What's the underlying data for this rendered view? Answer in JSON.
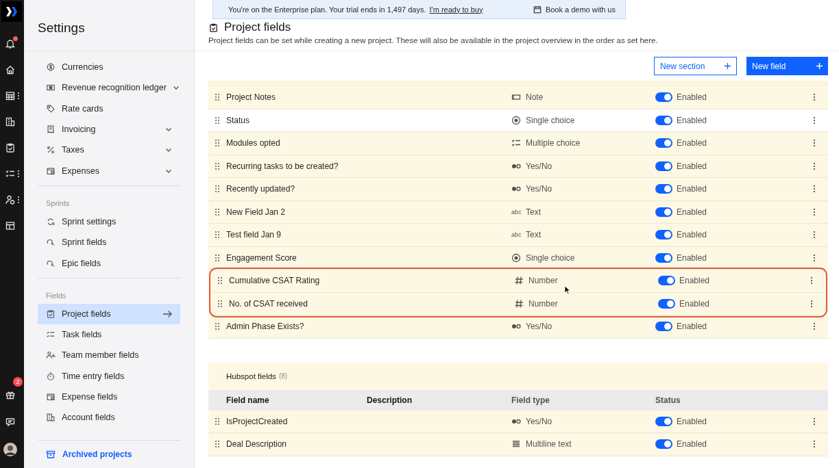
{
  "rail": {
    "top": [
      {
        "kind": "bell",
        "more": false,
        "notification": true
      },
      {
        "kind": "home",
        "more": false,
        "notification": false
      },
      {
        "kind": "calendar",
        "more": true,
        "notification": false
      },
      {
        "kind": "building",
        "more": false,
        "notification": false
      },
      {
        "kind": "clipboard",
        "more": false,
        "notification": false
      },
      {
        "kind": "checklist",
        "more": true,
        "notification": false
      },
      {
        "kind": "person",
        "more": true,
        "notification": false
      },
      {
        "kind": "layout",
        "more": false,
        "notification": false
      }
    ],
    "bottom": [
      {
        "kind": "gift",
        "badge": "2"
      },
      {
        "kind": "chat"
      },
      {
        "kind": "avatar"
      }
    ]
  },
  "sidebar": {
    "title": "Settings",
    "groups": [
      {
        "items": [
          {
            "label": "Currencies",
            "kind": "dollar",
            "expandable": false,
            "selected": false
          },
          {
            "label": "Revenue recognition ledger",
            "kind": "ledger",
            "expandable": true,
            "selected": false
          },
          {
            "label": "Rate cards",
            "kind": "tag",
            "expandable": false,
            "selected": false
          },
          {
            "label": "Invoicing",
            "kind": "receipt",
            "expandable": true,
            "selected": false
          },
          {
            "label": "Taxes",
            "kind": "percent",
            "expandable": true,
            "selected": false
          },
          {
            "label": "Expenses",
            "kind": "wallet",
            "expandable": true,
            "selected": false
          }
        ]
      },
      {
        "heading": "Sprints",
        "items": [
          {
            "label": "Sprint settings",
            "kind": "cycle",
            "expandable": false,
            "selected": false
          },
          {
            "label": "Sprint fields",
            "kind": "sprint",
            "expandable": false,
            "selected": false
          },
          {
            "label": "Epic fields",
            "kind": "sprint",
            "expandable": false,
            "selected": false
          }
        ]
      },
      {
        "heading": "Fields",
        "items": [
          {
            "label": "Project fields",
            "kind": "clipboard",
            "expandable": false,
            "selected": true
          },
          {
            "label": "Task fields",
            "kind": "checklist",
            "expandable": false,
            "selected": false
          },
          {
            "label": "Team member fields",
            "kind": "team",
            "expandable": false,
            "selected": false
          },
          {
            "label": "Time entry fields",
            "kind": "timer",
            "expandable": false,
            "selected": false
          },
          {
            "label": "Expense fields",
            "kind": "wallet",
            "expandable": false,
            "selected": false
          },
          {
            "label": "Account fields",
            "kind": "building",
            "expandable": false,
            "selected": false
          }
        ]
      }
    ],
    "footer": "Archived projects"
  },
  "banner": {
    "text": "You're on the Enterprise plan. Your trial ends in 1,497 days.",
    "link": "I'm ready to buy",
    "action": "Book a demo with us"
  },
  "page": {
    "title": "Project fields",
    "description": "Project fields can be set while creating a new project. These will also be available in the project overview in the order as set here.",
    "buttons": [
      {
        "label": "New section",
        "kind": "secondary"
      },
      {
        "label": "New field",
        "kind": "primary"
      }
    ]
  },
  "sections": [
    {
      "rows": [
        {
          "name": "Project Notes",
          "type": "Note",
          "kind": "note",
          "enabled": true,
          "status": "Enabled",
          "hovered": false,
          "annotated": false
        },
        {
          "name": "Status",
          "type": "Single choice",
          "kind": "single",
          "enabled": true,
          "status": "Enabled",
          "hovered": true,
          "annotated": false
        },
        {
          "name": "Modules opted",
          "type": "Multiple choice",
          "kind": "multiple",
          "enabled": true,
          "status": "Enabled",
          "hovered": false,
          "annotated": false
        },
        {
          "name": "Recurring tasks to be created?",
          "type": "Yes/No",
          "kind": "yesno",
          "enabled": true,
          "status": "Enabled",
          "hovered": false,
          "annotated": false
        },
        {
          "name": "Recently updated?",
          "type": "Yes/No",
          "kind": "yesno",
          "enabled": true,
          "status": "Enabled",
          "hovered": false,
          "annotated": false
        },
        {
          "name": "New Field Jan 2",
          "type": "Text",
          "kind": "text",
          "glyph": "abc",
          "enabled": true,
          "status": "Enabled",
          "hovered": false,
          "annotated": false
        },
        {
          "name": "Test field Jan 9",
          "type": "Text",
          "kind": "text",
          "glyph": "abc",
          "enabled": true,
          "status": "Enabled",
          "hovered": false,
          "annotated": false
        },
        {
          "name": "Engagement Score",
          "type": "Single choice",
          "kind": "single",
          "enabled": true,
          "status": "Enabled",
          "hovered": false,
          "annotated": false
        },
        {
          "name": "Cumulative CSAT Rating",
          "type": "Number",
          "kind": "number",
          "enabled": true,
          "status": "Enabled",
          "hovered": false,
          "annotated": true
        },
        {
          "name": "No. of CSAT received",
          "type": "Number",
          "kind": "number",
          "enabled": true,
          "status": "Enabled",
          "hovered": false,
          "annotated": true
        },
        {
          "name": "Admin Phase Exists?",
          "type": "Yes/No",
          "kind": "yesno",
          "enabled": true,
          "status": "Enabled",
          "hovered": false,
          "annotated": false
        }
      ]
    },
    {
      "title": "Hubspot fields",
      "count": "(8)",
      "columns": [
        "Field name",
        "Description",
        "Field type",
        "Status"
      ],
      "rows": [
        {
          "name": "IsProjectCreated",
          "type": "Yes/No",
          "kind": "yesno",
          "enabled": true,
          "status": "Enabled",
          "hovered": false,
          "annotated": false
        },
        {
          "name": "Deal Description",
          "type": "Multiline text",
          "kind": "multiline",
          "enabled": true,
          "status": "Enabled",
          "hovered": false,
          "annotated": false
        }
      ]
    }
  ]
}
